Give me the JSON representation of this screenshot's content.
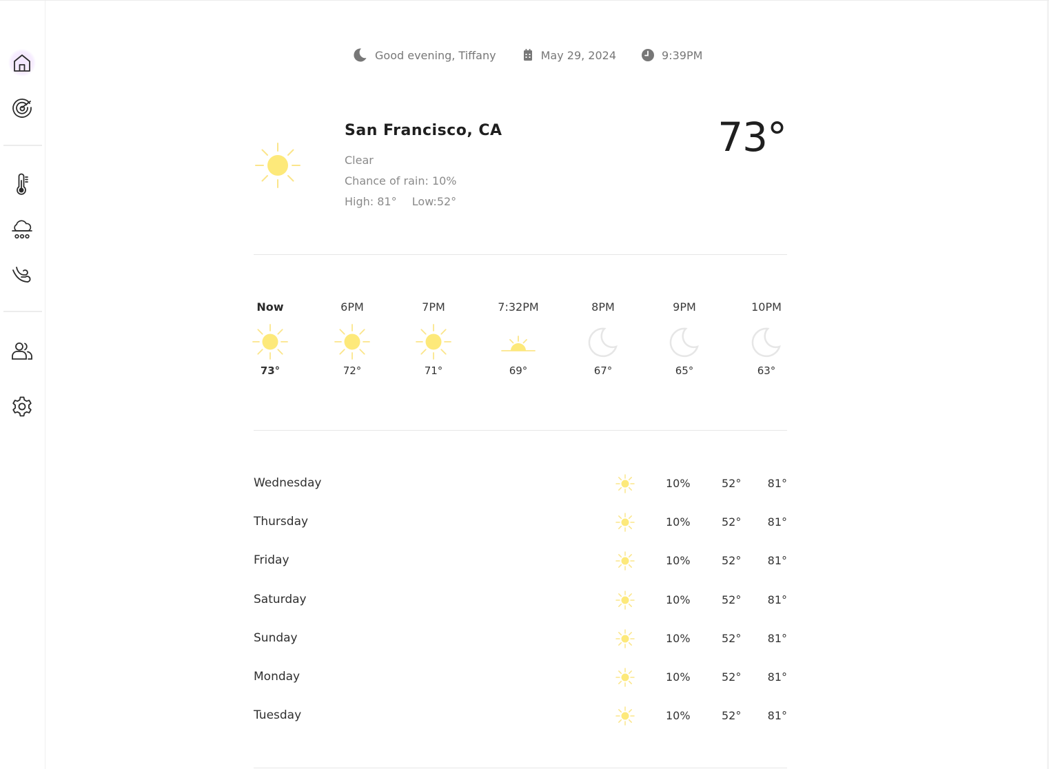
{
  "topbar": {
    "greeting": "Good evening, Tiffany",
    "date": "May 29, 2024",
    "time": "9:39PM"
  },
  "current": {
    "city": "San Francisco, CA",
    "condition": "Clear",
    "rain": "Chance of rain: 10%",
    "high": "High: 81°",
    "low": "Low:52°",
    "temp": "73°",
    "icon": "sun-icon"
  },
  "hourly": [
    {
      "label": "Now",
      "temp": "73°",
      "icon": "sun"
    },
    {
      "label": "6PM",
      "temp": "72°",
      "icon": "sun"
    },
    {
      "label": "7PM",
      "temp": "71°",
      "icon": "sun"
    },
    {
      "label": "7:32PM",
      "temp": "69°",
      "icon": "sunset"
    },
    {
      "label": "8PM",
      "temp": "67°",
      "icon": "moon"
    },
    {
      "label": "9PM",
      "temp": "65°",
      "icon": "moon"
    },
    {
      "label": "10PM",
      "temp": "63°",
      "icon": "moon"
    }
  ],
  "daily": [
    {
      "day": "Wednesday",
      "rain": "10%",
      "low": "52°",
      "high": "81°",
      "icon": "sun"
    },
    {
      "day": "Thursday",
      "rain": "10%",
      "low": "52°",
      "high": "81°",
      "icon": "sun"
    },
    {
      "day": "Friday",
      "rain": "10%",
      "low": "52°",
      "high": "81°",
      "icon": "sun"
    },
    {
      "day": "Saturday",
      "rain": "10%",
      "low": "52°",
      "high": "81°",
      "icon": "sun"
    },
    {
      "day": "Sunday",
      "rain": "10%",
      "low": "52°",
      "high": "81°",
      "icon": "sun"
    },
    {
      "day": "Monday",
      "rain": "10%",
      "low": "52°",
      "high": "81°",
      "icon": "sun"
    },
    {
      "day": "Tuesday",
      "rain": "10%",
      "low": "52°",
      "high": "81°",
      "icon": "sun"
    }
  ],
  "sidebar": {
    "items": [
      {
        "icon": "home-icon",
        "active": true
      },
      {
        "icon": "radar-icon",
        "active": false
      },
      {
        "icon": "thermometer-icon",
        "active": false
      },
      {
        "icon": "rain-cloud-icon",
        "active": false
      },
      {
        "icon": "wind-icon",
        "active": false
      },
      {
        "icon": "people-icon",
        "active": false
      },
      {
        "icon": "gear-icon",
        "active": false
      }
    ]
  },
  "colors": {
    "sun": "#fde97a",
    "sun_ray": "#fbe58a",
    "moon": "#e9e9e9",
    "active_nav": "#f3e6ff",
    "nav_icon": "#2b2b2b",
    "muted_text": "#8a8a8a"
  }
}
